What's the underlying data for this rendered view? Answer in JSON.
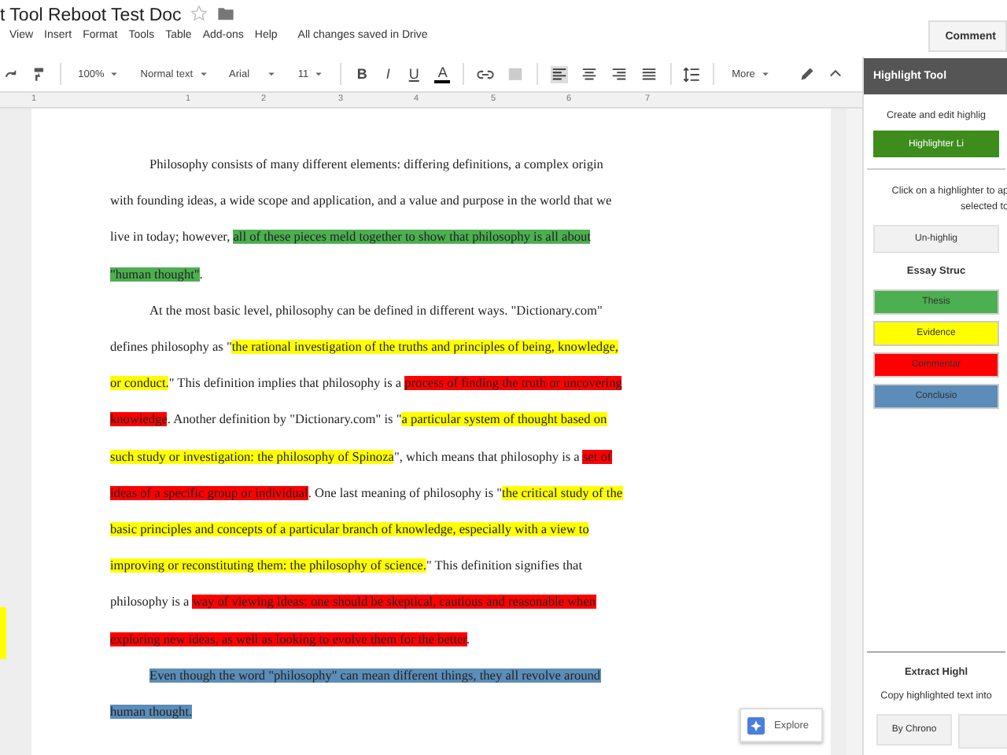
{
  "document": {
    "title": "t Tool Reboot Test Doc",
    "menu": [
      "View",
      "Insert",
      "Format",
      "Tools",
      "Table",
      "Add-ons",
      "Help"
    ],
    "save_status": "All changes saved in Drive",
    "comments_button": "Comment"
  },
  "toolbar": {
    "zoom": "100%",
    "style": "Normal text",
    "font": "Arial",
    "size": "11",
    "format_buttons": [
      "B",
      "I",
      "U",
      "A"
    ],
    "more": "More"
  },
  "ruler": [
    "1",
    "1",
    "2",
    "3",
    "4",
    "5",
    "6",
    "7"
  ],
  "paragraphs": [
    {
      "segments": [
        {
          "text": "Philosophy consists of many different elements: differing definitions, a complex origin with founding ideas, a wide scope and application, and a value and purpose in the world that we live in today; however, "
        },
        {
          "text": "all of these pieces meld together to show that philosophy is all about \"human thought\"",
          "color": "#4caf50"
        },
        {
          "text": "."
        }
      ]
    },
    {
      "segments": [
        {
          "text": "At the most basic level, philosophy can be defined in different ways. \"Dictionary.com\" defines philosophy as \""
        },
        {
          "text": "the rational investigation of the truths and principles of being, knowledge, or conduct.",
          "color": "#ffff00"
        },
        {
          "text": "\" This definition implies that philosophy is a "
        },
        {
          "text": "process of finding the truth or uncovering knowledge",
          "color": "#ff0000"
        },
        {
          "text": ". Another definition by \"Dictionary.com\" is \""
        },
        {
          "text": "a particular system of thought based on such study or investigation: the philosophy of Spinoza",
          "color": "#ffff00"
        },
        {
          "text": "\", which means that philosophy is a "
        },
        {
          "text": "set of ideas of a specific group or individual",
          "color": "#ff0000"
        },
        {
          "text": ". One last meaning of philosophy is \""
        },
        {
          "text": "the critical study of the basic principles and concepts of a particular branch of knowledge, especially with a view to improving or reconstituting them: the philosophy of science.",
          "color": "#ffff00"
        },
        {
          "text": "\" This definition signifies that philosophy is a "
        },
        {
          "text": "way of viewing ideas: one should be skeptical, cautious and reasonable when exploring new ideas, as well as looking to evolve them for the better",
          "color": "#ff0000"
        },
        {
          "text": "."
        }
      ]
    },
    {
      "segments": [
        {
          "text": "Even though the word \"philosophy\" can mean different things, they all revolve around human thought.",
          "color": "#5b8db8"
        }
      ]
    }
  ],
  "explore_button": "Explore",
  "sidebar": {
    "title": "Highlight Tool",
    "intro": "Create and edit highlig",
    "library_button": "Highlighter Li",
    "instructions": [
      "Click on a highlighter to ap",
      "selected to"
    ],
    "unhighlight_button": "Un-highlig",
    "set_title": "Essay Struc",
    "highlighters": [
      {
        "label": "Thesis",
        "color": "#4caf50"
      },
      {
        "label": "Evidence",
        "color": "#ffff00"
      },
      {
        "label": "Commentar",
        "color": "#ff0000"
      },
      {
        "label": "Conclusio",
        "color": "#5b8db8"
      }
    ],
    "extract_title": "Extract Highl",
    "extract_text": "Copy highlighted text into",
    "extract_buttons": [
      "By Chrono"
    ]
  }
}
